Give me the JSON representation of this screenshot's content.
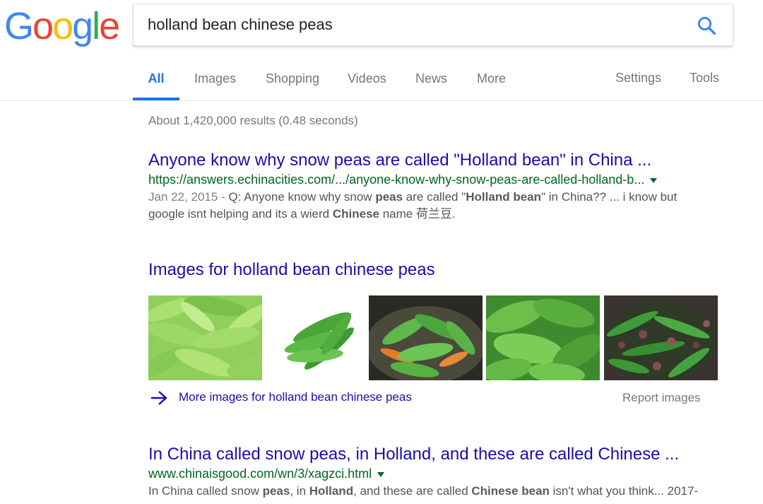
{
  "logo": {
    "letters": [
      "G",
      "o",
      "o",
      "g",
      "l",
      "e"
    ],
    "colors": [
      "#4285f4",
      "#ea4335",
      "#fbbc05",
      "#4285f4",
      "#34a853",
      "#ea4335"
    ]
  },
  "search": {
    "query": "holland bean chinese peas",
    "icon": "search-icon"
  },
  "tabs": [
    {
      "label": "All"
    },
    {
      "label": "Images"
    },
    {
      "label": "Shopping"
    },
    {
      "label": "Videos"
    },
    {
      "label": "News"
    },
    {
      "label": "More"
    }
  ],
  "tools": {
    "settings": "Settings",
    "tools": "Tools"
  },
  "stats": "About 1,420,000 results (0.48 seconds)",
  "result1": {
    "title": "Anyone know why snow peas are called \"Holland bean\" in China ...",
    "url": "https://answers.echinacities.com/.../anyone-know-why-snow-peas-are-called-holland-b...",
    "date": "Jan 22, 2015 - ",
    "snippet_parts": [
      "Q: Anyone know why snow ",
      "peas",
      " are called \"",
      "Holland bean",
      "\" in China?? ... i know but google isnt helping and its a wierd ",
      "Chinese",
      " name 荷兰豆."
    ]
  },
  "images": {
    "heading": "Images for holland bean chinese peas",
    "more_label": "More images for holland bean chinese peas",
    "report_label": "Report images"
  },
  "result2": {
    "title": "In China called snow peas, in Holland, and these are called Chinese ...",
    "url": "www.chinaisgood.com/wn/3/xagzci.html",
    "snippet_parts": [
      "In China called snow ",
      "peas",
      ", in ",
      "Holland",
      ", and these are called ",
      "Chinese bean",
      " isn't what you think... 2017-"
    ]
  },
  "colors": {
    "link": "#1a0dab",
    "url": "#006621",
    "accent": "#1a73e8"
  }
}
